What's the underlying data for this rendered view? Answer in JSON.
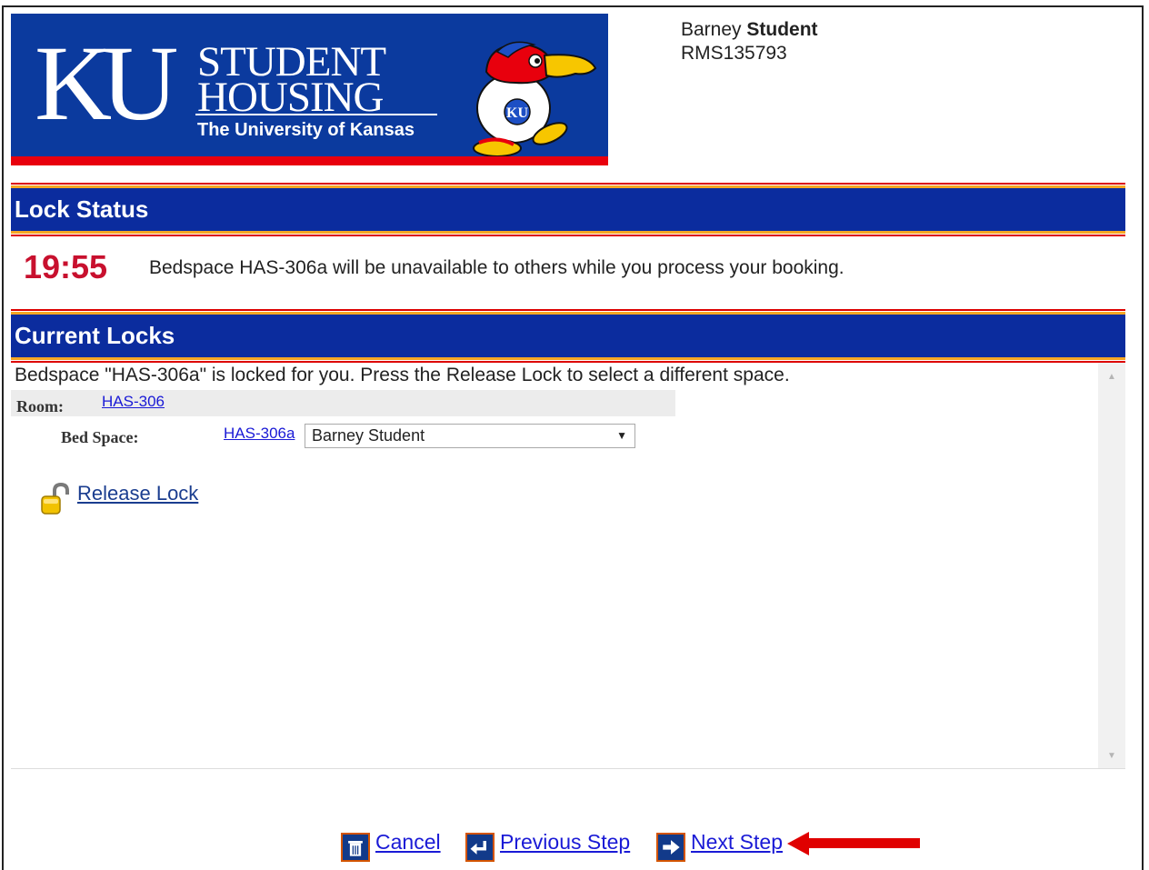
{
  "banner": {
    "logo_letters": "KU",
    "title_line1": "STUDENT",
    "title_line2": "HOUSING",
    "university": "The University of Kansas",
    "mascot_badge": "KU",
    "colors": {
      "blue": "#0b3a9e",
      "red": "#e8000d"
    }
  },
  "user": {
    "first_name": "Barney",
    "last_name": "Student",
    "id": "RMS135793"
  },
  "lock_status": {
    "heading": "Lock Status",
    "timer": "19:55",
    "message": "Bedspace HAS-306a will be unavailable to others while you process your booking."
  },
  "current_locks": {
    "heading": "Current Locks",
    "message": "Bedspace \"HAS-306a\" is locked for you. Press the Release Lock to select a different space.",
    "room_label": "Room:",
    "room_value": "HAS-306",
    "bed_label": "Bed Space:",
    "bed_value": "HAS-306a",
    "bed_occupant_selected": "Barney Student",
    "release_label": "Release Lock"
  },
  "nav": {
    "cancel_label": "Cancel",
    "previous_label": "Previous Step",
    "next_label": "Next Step"
  },
  "icons": {
    "cancel": "trash-icon",
    "previous": "back-arrow-icon",
    "next": "forward-arrow-icon",
    "release": "padlock-open-icon",
    "annotation": "red-arrow-icon"
  },
  "colors": {
    "header_blue": "#0b2c9e",
    "header_stripe": "#f5a623",
    "timer_red": "#c8102e",
    "link_blue": "#1a1ad6",
    "annotation_red": "#e00000"
  }
}
